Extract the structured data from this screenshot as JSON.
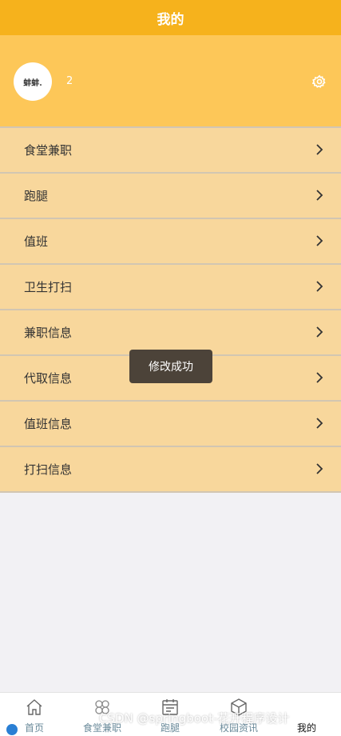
{
  "header": {
    "title": "我的"
  },
  "profile": {
    "avatar_text": "蚌蚌.",
    "username": "2",
    "settings_icon": "gear-icon"
  },
  "menu": [
    {
      "label": "食堂兼职"
    },
    {
      "label": "跑腿"
    },
    {
      "label": "值班"
    },
    {
      "label": "卫生打扫"
    },
    {
      "label": "兼职信息"
    },
    {
      "label": "代取信息"
    },
    {
      "label": "值班信息"
    },
    {
      "label": "打扫信息"
    }
  ],
  "toast": {
    "text": "修改成功"
  },
  "tabbar": {
    "items": [
      {
        "label": "首页",
        "icon": "home-icon"
      },
      {
        "label": "食堂兼职",
        "icon": "clover-icon"
      },
      {
        "label": "跑腿",
        "icon": "calendar-icon"
      },
      {
        "label": "校园资讯",
        "icon": "cube-icon"
      },
      {
        "label": "我的",
        "icon": "user-icon"
      }
    ]
  },
  "watermark": "CSDN @springboot-花开程序设计",
  "colors": {
    "header": "#f6b21c",
    "profile": "#fdc758",
    "menu_item": "#f8d79c"
  }
}
